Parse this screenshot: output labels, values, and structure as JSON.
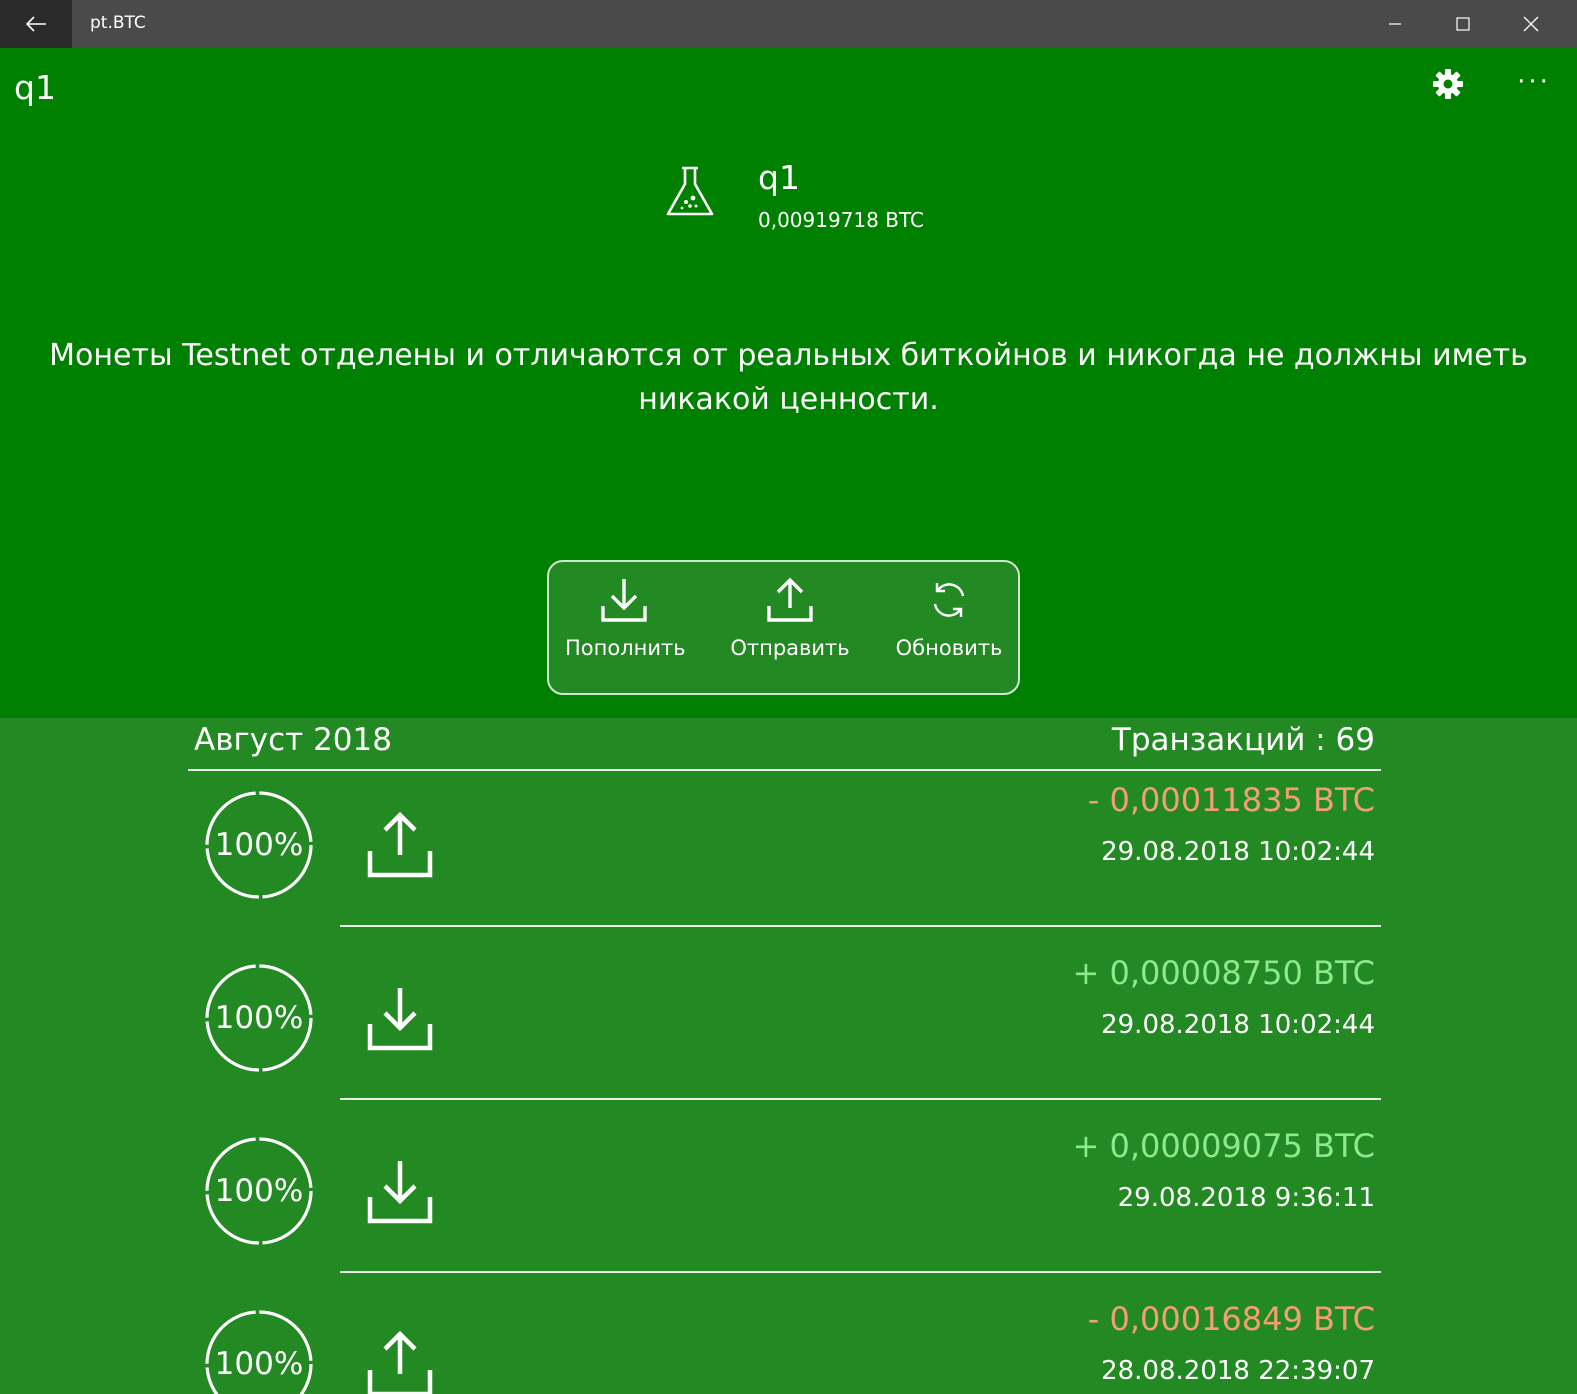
{
  "window": {
    "title": "pt.BTC",
    "back_icon": "arrow-left-icon",
    "minimize_icon": "minimize-icon",
    "maximize_icon": "maximize-icon",
    "close_icon": "close-icon"
  },
  "appbar": {
    "title": "q1",
    "settings_icon": "gear-icon",
    "more_label": "···"
  },
  "wallet": {
    "icon": "flask-icon",
    "name": "q1",
    "balance": "0,00919718 BTC"
  },
  "notice": "Монеты Testnet отделены и отличаются от реальных биткойнов и никогда не должны иметь никакой ценности.",
  "actions": {
    "deposit_label": "Пополнить",
    "send_label": "Отправить",
    "refresh_label": "Обновить"
  },
  "transactions": {
    "month": "Август 2018",
    "count_label": "Транзакций :  69",
    "items": [
      {
        "progress": "100%",
        "direction": "send",
        "amount": "- 0,00011835 BTC",
        "date": "29.08.2018 10:02:44"
      },
      {
        "progress": "100%",
        "direction": "receive",
        "amount": "+ 0,00008750 BTC",
        "date": "29.08.2018 10:02:44"
      },
      {
        "progress": "100%",
        "direction": "receive",
        "amount": "+ 0,00009075 BTC",
        "date": "29.08.2018 9:36:11"
      },
      {
        "progress": "100%",
        "direction": "send",
        "amount": "- 0,00016849 BTC",
        "date": "28.08.2018 22:39:07"
      }
    ]
  },
  "colors": {
    "hero_bg": "#008000",
    "list_bg": "#238a23",
    "outgoing": "#f2a072",
    "incoming": "#8fe88f",
    "titlebar": "#4a4a4a"
  }
}
